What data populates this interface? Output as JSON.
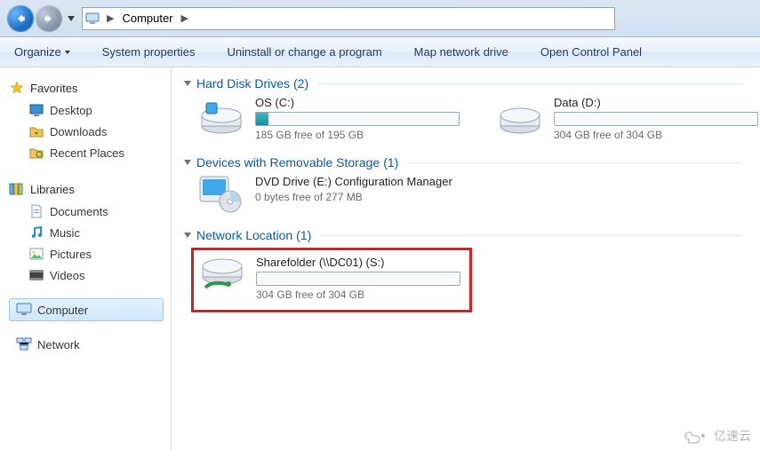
{
  "breadcrumb": {
    "root_icon": "computer-small-icon",
    "location": "Computer"
  },
  "toolbar": {
    "organize": "Organize",
    "system_properties": "System properties",
    "uninstall": "Uninstall or change a program",
    "map_drive": "Map network drive",
    "control_panel": "Open Control Panel"
  },
  "sidebar": {
    "favorites": {
      "label": "Favorites",
      "items": [
        {
          "label": "Desktop",
          "icon": "desktop-icon"
        },
        {
          "label": "Downloads",
          "icon": "downloads-icon"
        },
        {
          "label": "Recent Places",
          "icon": "recent-icon"
        }
      ]
    },
    "libraries": {
      "label": "Libraries",
      "items": [
        {
          "label": "Documents",
          "icon": "documents-icon"
        },
        {
          "label": "Music",
          "icon": "music-icon"
        },
        {
          "label": "Pictures",
          "icon": "pictures-icon"
        },
        {
          "label": "Videos",
          "icon": "videos-icon"
        }
      ]
    },
    "computer": {
      "label": "Computer"
    },
    "network": {
      "label": "Network"
    }
  },
  "main": {
    "hdd": {
      "title": "Hard Disk Drives",
      "count": "(2)",
      "drives": [
        {
          "name": "OS (C:)",
          "free": "185 GB free of 195 GB",
          "fill_pct": 6
        },
        {
          "name": "Data (D:)",
          "free": "304 GB free of 304 GB",
          "fill_pct": 0
        }
      ]
    },
    "removable": {
      "title": "Devices with Removable Storage",
      "count": "(1)",
      "drives": [
        {
          "name": "DVD Drive (E:) Configuration Manager",
          "free": "0 bytes free of 277 MB"
        }
      ]
    },
    "network_loc": {
      "title": "Network Location",
      "count": "(1)",
      "drives": [
        {
          "name": "Sharefolder (\\\\DC01) (S:)",
          "free": "304 GB free of 304 GB",
          "fill_pct": 0
        }
      ]
    }
  },
  "watermark": "亿速云"
}
